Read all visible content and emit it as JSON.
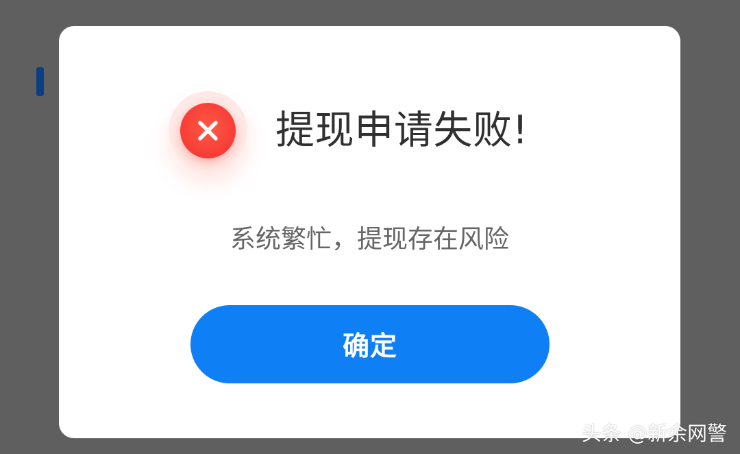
{
  "dialog": {
    "title": "提现申请失败!",
    "message": "系统繁忙，提现存在风险",
    "button_label": "确定",
    "icon": "close-icon"
  },
  "watermark": {
    "text": "头条 @新余网警"
  },
  "colors": {
    "backdrop": "#5f5f5f",
    "dialog_background": "#ffffff",
    "accent": "#0f7ff6",
    "error": "#f73f37",
    "title_text": "#303030",
    "message_text": "#666666",
    "side_accent": "#0a3f83"
  }
}
